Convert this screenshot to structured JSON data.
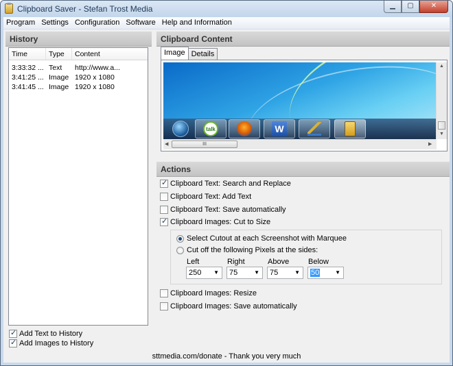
{
  "window": {
    "title": "Clipboard Saver - Stefan Trost Media"
  },
  "window_controls": {
    "minimize": "▁",
    "maximize": "▢",
    "close": "✕"
  },
  "menu": [
    "Program",
    "Settings",
    "Configuration",
    "Software",
    "Help and Information"
  ],
  "history": {
    "title": "History",
    "columns": [
      "Time",
      "Type",
      "Content"
    ],
    "rows": [
      {
        "time": "3:33:32 ...",
        "type": "Text",
        "content": "http://www.a..."
      },
      {
        "time": "3:41:25 ...",
        "type": "Image",
        "content": "1920 x 1080"
      },
      {
        "time": "3:41:45 ...",
        "type": "Image",
        "content": "1920 x 1080"
      }
    ],
    "add_text": {
      "label": "Add Text to History",
      "checked": true
    },
    "add_images": {
      "label": "Add Images to History",
      "checked": true
    }
  },
  "clipboard": {
    "title": "Clipboard Content",
    "tabs": [
      "Image",
      "Details"
    ],
    "active_tab": "Image",
    "preview_icons": [
      "windows-orb-icon",
      "google-talk-icon",
      "firefox-icon",
      "word-icon",
      "paint-icon",
      "clipboard-icon"
    ],
    "talk_label": "talk",
    "word_label": "W",
    "hscroll_grip": "III"
  },
  "actions": {
    "title": "Actions",
    "items": [
      {
        "label": "Clipboard Text: Search and Replace",
        "checked": true
      },
      {
        "label": "Clipboard Text: Add Text",
        "checked": false
      },
      {
        "label": "Clipboard Text: Save automatically",
        "checked": false
      },
      {
        "label": "Clipboard Images: Cut to Size",
        "checked": true
      },
      {
        "label": "Clipboard Images: Resize",
        "checked": false
      },
      {
        "label": "Clipboard Images: Save automatically",
        "checked": false
      }
    ],
    "cut": {
      "option_marquee": "Select Cutout at each Screenshot with Marquee",
      "option_pixels": "Cut off the following Pixels at the sides:",
      "selected": "marquee",
      "fields": [
        {
          "label": "Left",
          "value": "250"
        },
        {
          "label": "Right",
          "value": "75"
        },
        {
          "label": "Above",
          "value": "75"
        },
        {
          "label": "Below",
          "value": "50"
        }
      ]
    }
  },
  "status": {
    "text": "sttmedia.com/donate - Thank you very much"
  }
}
